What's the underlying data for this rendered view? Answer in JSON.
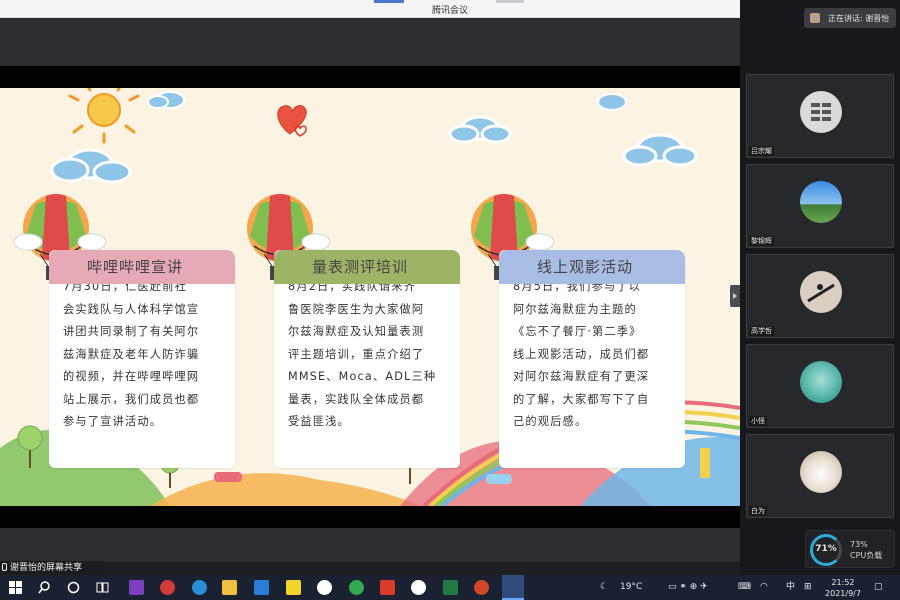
{
  "window": {
    "title": "腾讯会议"
  },
  "speaking": {
    "label": "正在讲话: 谢晋怡"
  },
  "slide": {
    "cards": [
      {
        "title": "哔哩哔哩宣讲",
        "color": "#e6a9b6",
        "lines": [
          "7月30日，仁医赴前社",
          "会实践队与人体科学馆宣",
          "讲团共同录制了有关阿尔",
          "兹海默症及老年人防诈骗",
          "的视频，并在哔哩哔哩网",
          "站上展示，我们成员也都",
          "参与了宣讲活动。"
        ]
      },
      {
        "title": "量表测评培训",
        "color": "#9db466",
        "lines": [
          "8月2日，实践队请来齐",
          "鲁医院李医生为大家做阿",
          "尔兹海默症及认知量表测",
          "评主题培训，重点介绍了",
          "MMSE、Moca、ADL三种",
          "量表，实践队全体成员都",
          "受益匪浅。"
        ]
      },
      {
        "title": "线上观影活动",
        "color": "#a8bde3",
        "lines": [
          "8月5日，我们参与了以",
          "阿尔兹海默症为主题的",
          "《忘不了餐厅·第二季》",
          "线上观影活动，成员们都",
          "对阿尔兹海默症有了更深",
          "的了解，大家都写下了自",
          "己的观后感。"
        ]
      }
    ]
  },
  "participants": [
    {
      "name": "吕宗耀"
    },
    {
      "name": "黎锦辉"
    },
    {
      "name": "高学哲"
    },
    {
      "name": "小怪"
    },
    {
      "name": "白为"
    }
  ],
  "cpu": {
    "percent": "71%",
    "label1": "73%",
    "label2": "CPU负载"
  },
  "share_label": "谢晋怡的屏幕共享",
  "taskbar": {
    "weather": "19°C",
    "ime": "中",
    "time": "21:52",
    "date": "2021/9/7"
  }
}
